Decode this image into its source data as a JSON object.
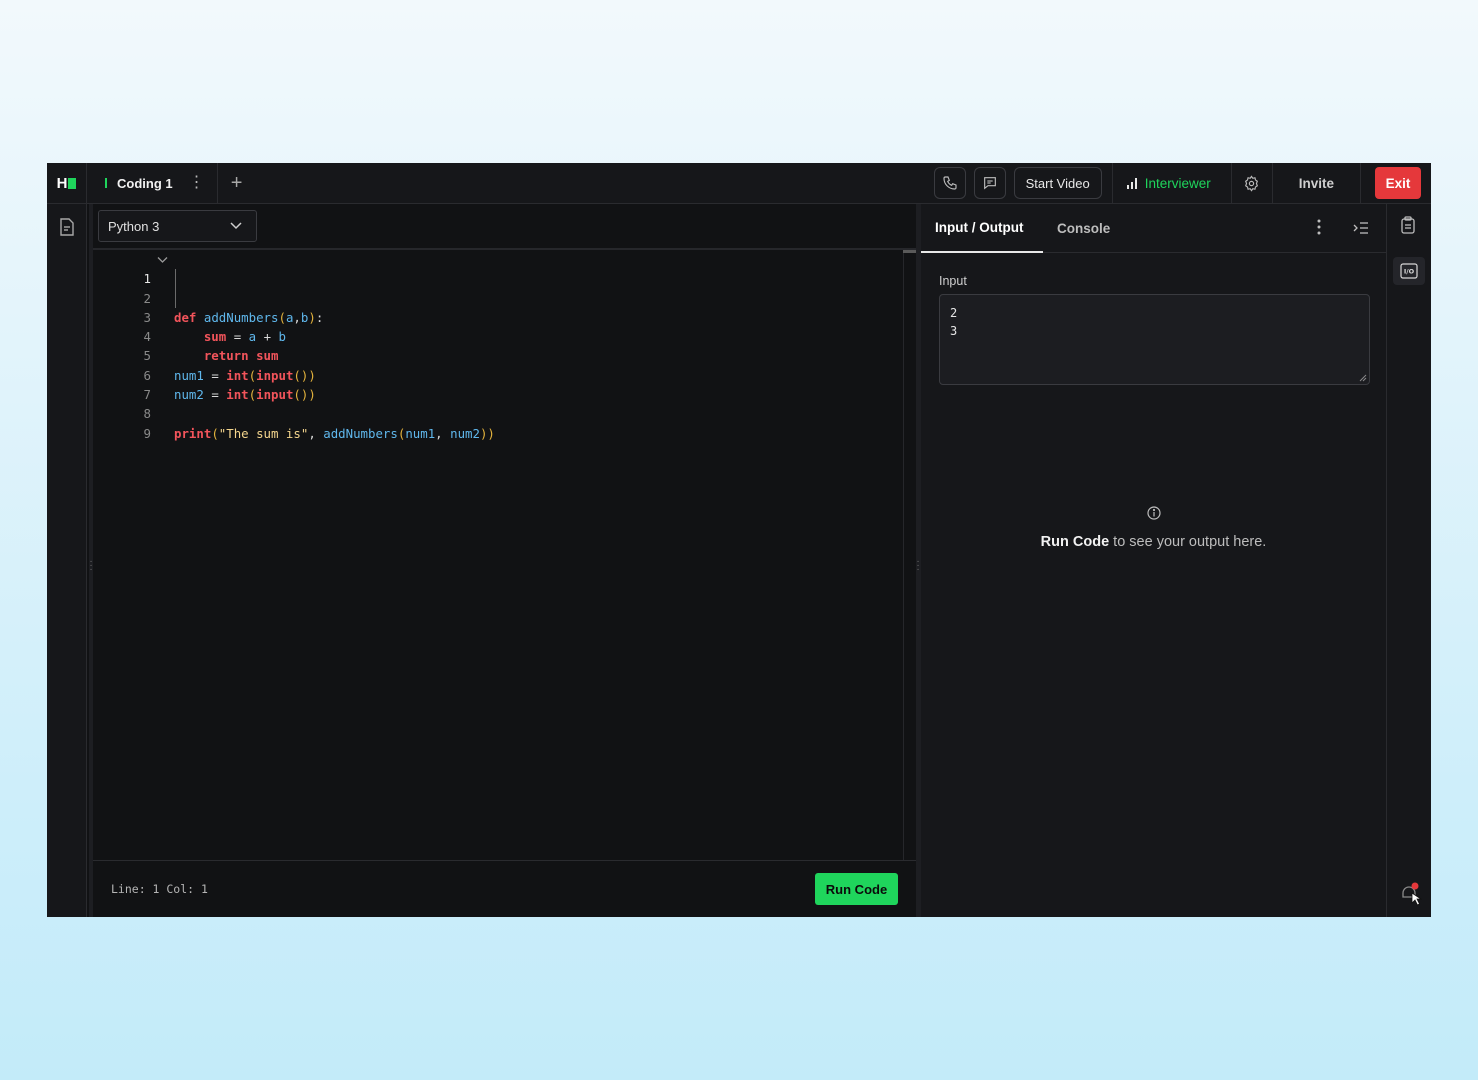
{
  "topbar": {
    "logo_text": "H",
    "tab_label": "Coding 1",
    "start_video_label": "Start Video",
    "interviewer_label": "Interviewer",
    "invite_label": "Invite",
    "exit_label": "Exit",
    "accent_color": "#1fd55c",
    "exit_color": "#e5383b"
  },
  "editor": {
    "language": "Python 3",
    "line_numbers": [
      "1",
      "2",
      "3",
      "4",
      "5",
      "6",
      "7",
      "8",
      "9"
    ],
    "cursor_position": "Line: 1 Col: 1",
    "run_label": "Run Code"
  },
  "code_lines": [
    "def addNumbers(a,b):",
    "    sum = a + b",
    "    return sum",
    "",
    "num1 = int(input())",
    "num2 = int(input())",
    "",
    "print(\"The sum is\", addNumbers(num1, num2))",
    ""
  ],
  "right_panel": {
    "tabs": [
      {
        "label": "Input / Output",
        "active": true
      },
      {
        "label": "Console",
        "active": false
      }
    ],
    "input_label": "Input",
    "input_value": "2\n3",
    "output_hint_bold": "Run Code",
    "output_hint_rest": " to see your output here."
  },
  "icons": [
    "file-icon",
    "phone-icon",
    "chat-icon",
    "signal-bars-icon",
    "gear-icon",
    "kebab-icon",
    "collapse-panel-icon",
    "clipboard-icon",
    "io-icon",
    "info-icon",
    "notification-icon",
    "chevron-down-icon"
  ]
}
